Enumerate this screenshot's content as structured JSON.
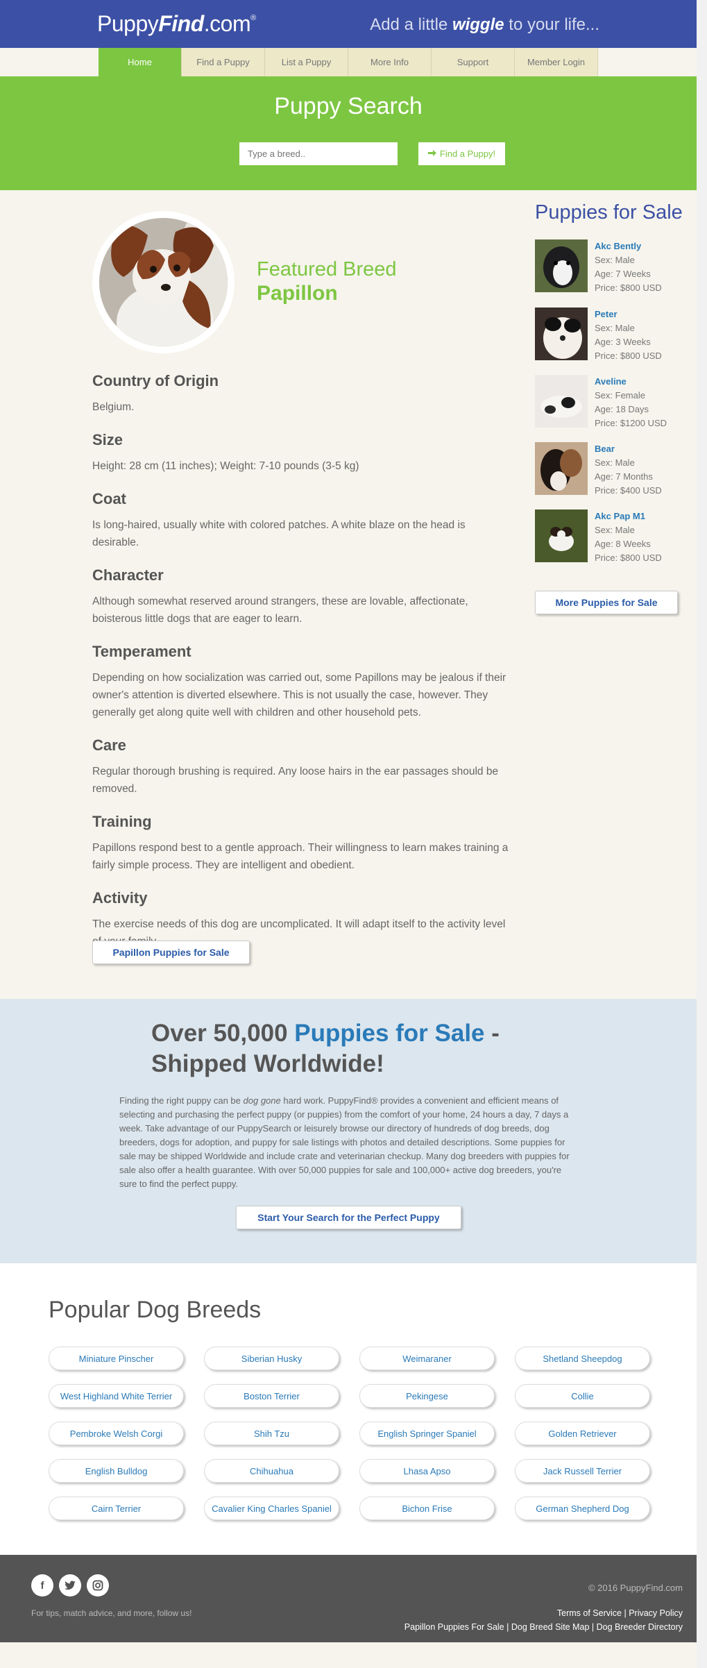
{
  "header": {
    "logo_left": "Puppy",
    "logo_bold": "Find",
    "logo_suffix": ".com",
    "logo_mark": "®",
    "tagline_before": "Add a little ",
    "tagline_bold": "wiggle",
    "tagline_after": " to your life..."
  },
  "nav": {
    "items": [
      "Home",
      "Find a Puppy",
      "List a Puppy",
      "More Info",
      "Support",
      "Member Login"
    ],
    "active": "Home"
  },
  "search": {
    "title": "Puppy Search",
    "placeholder": "Type a breed..",
    "button_label": "Find a Puppy!",
    "button_icon": "arrow-right-icon"
  },
  "featured": {
    "label": "Featured Breed",
    "name": "Papillon",
    "sections": [
      {
        "heading": "Country of Origin",
        "text": "Belgium."
      },
      {
        "heading": "Size",
        "text": "Height: 28 cm (11 inches); Weight: 7-10 pounds (3-5 kg)"
      },
      {
        "heading": "Coat",
        "text": "Is long-haired, usually white with colored patches. A white blaze on the head is desirable."
      },
      {
        "heading": "Character",
        "text": "Although somewhat reserved around strangers, these are lovable, affectionate, boisterous little dogs that are eager to learn."
      },
      {
        "heading": "Temperament",
        "text": "Depending on how socialization was carried out, some Papillons may be jealous if their owner's attention is diverted elsewhere. This is not usually the case, however. They generally get along quite well with children and other household pets."
      },
      {
        "heading": "Care",
        "text": "Regular thorough brushing is required. Any loose hairs in the ear passages should be removed."
      },
      {
        "heading": "Training",
        "text": "Papillons respond best to a gentle approach. Their willingness to learn makes training a fairly simple process. They are intelligent and obedient."
      },
      {
        "heading": "Activity",
        "text": "The exercise needs of this dog are uncomplicated. It will adapt itself to the activity level of your family."
      }
    ],
    "cta_label": "Papillon Puppies for Sale"
  },
  "sidebar": {
    "title": "Puppies for Sale",
    "puppies": [
      {
        "name": "Akc Bently",
        "sex": "Sex: Male",
        "age": "Age: 7 Weeks",
        "price": "Price: $800 USD"
      },
      {
        "name": "Peter",
        "sex": "Sex: Male",
        "age": "Age: 3 Weeks",
        "price": "Price: $800 USD"
      },
      {
        "name": "Aveline",
        "sex": "Sex: Female",
        "age": "Age: 18 Days",
        "price": "Price: $1200 USD"
      },
      {
        "name": "Bear",
        "sex": "Sex: Male",
        "age": "Age: 7 Months",
        "price": "Price: $400 USD"
      },
      {
        "name": "Akc Pap M1",
        "sex": "Sex: Male",
        "age": "Age: 8 Weeks",
        "price": "Price: $800 USD"
      }
    ],
    "more_label": "More Puppies for Sale"
  },
  "promo": {
    "heading_start": "Over 50,000 ",
    "heading_blue": "Puppies for Sale",
    "heading_end": " - Shipped Worldwide!",
    "body_before": "Finding the right puppy can be ",
    "body_italic": "dog gone",
    "body_after": " hard work. PuppyFind® provides a convenient and efficient means of selecting and purchasing the perfect puppy (or puppies) from the comfort of your home, 24 hours a day, 7 days a week. Take advantage of our PuppySearch or leisurely browse our directory of hundreds of dog breeds, dog breeders, dogs for adoption, and puppy for sale listings with photos and detailed descriptions. Some puppies for sale may be shipped Worldwide and include crate and veterinarian checkup. Many dog breeders with puppies for sale also offer a health guarantee. With over 50,000 puppies for sale and 100,000+ active dog breeders, you're sure to find the perfect puppy.",
    "button_label": "Start Your Search for the Perfect Puppy"
  },
  "popular": {
    "title": "Popular Dog Breeds",
    "breeds": [
      "Miniature Pinscher",
      "Siberian Husky",
      "Weimaraner",
      "Shetland Sheepdog",
      "West Highland White Terrier",
      "Boston Terrier",
      "Pekingese",
      "Collie",
      "Pembroke Welsh Corgi",
      "Shih Tzu",
      "English Springer Spaniel",
      "Golden Retriever",
      "English Bulldog",
      "Chihuahua",
      "Lhasa Apso",
      "Jack Russell Terrier",
      "Cairn Terrier",
      "Cavalier King Charles Spaniel",
      "Bichon Frise",
      "German Shepherd Dog"
    ]
  },
  "footer": {
    "social_icons": [
      "facebook-icon",
      "twitter-icon",
      "instagram-icon"
    ],
    "follow_text": "For tips, match advice, and more, follow us!",
    "copyright": "© 2016 PuppyFind.com",
    "links_row1": [
      "Terms of Service",
      "Privacy Policy"
    ],
    "links_row2": [
      "Papillon Puppies For Sale",
      "Dog Breed Site Map",
      "Dog Breeder Directory"
    ]
  },
  "colors": {
    "header_blue": "#3c50a5",
    "brand_green": "#7dc642",
    "link_blue": "#2a7ab8",
    "promo_bg": "#dce6ee",
    "footer_gray": "#545454"
  }
}
